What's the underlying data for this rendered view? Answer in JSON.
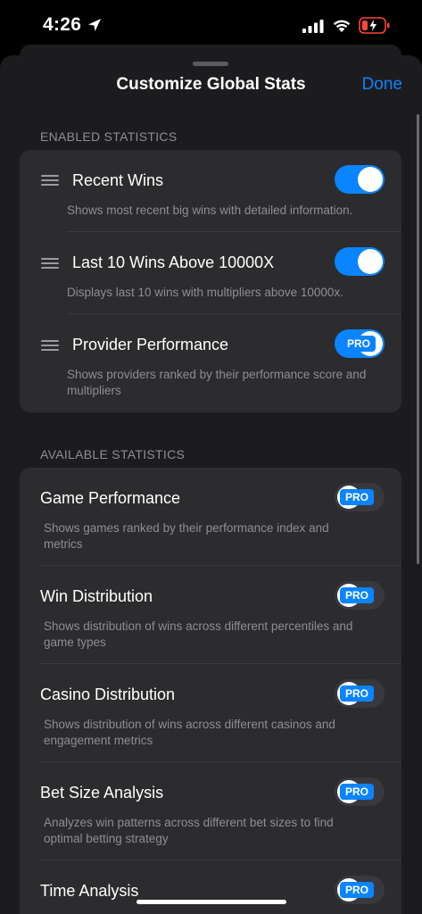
{
  "status_bar": {
    "time": "4:26"
  },
  "header": {
    "title": "Customize Global Stats",
    "done_label": "Done"
  },
  "enabled_section": {
    "heading": "ENABLED STATISTICS",
    "items": [
      {
        "title": "Recent Wins",
        "description": "Shows most recent big wins with detailed information.",
        "toggle": "on"
      },
      {
        "title": "Last 10 Wins Above 10000X",
        "description": "Displays last 10 wins with multipliers above 10000x.",
        "toggle": "on"
      },
      {
        "title": "Provider Performance",
        "description": "Shows providers ranked by their performance score and multipliers",
        "toggle": "pro-on",
        "badge": "PRO"
      }
    ]
  },
  "available_section": {
    "heading": "AVAILABLE STATISTICS",
    "items": [
      {
        "title": "Game Performance",
        "description": "Shows games ranked by their performance index and metrics",
        "badge": "PRO"
      },
      {
        "title": "Win Distribution",
        "description": "Shows distribution of wins across different percentiles and game types",
        "badge": "PRO"
      },
      {
        "title": "Casino Distribution",
        "description": "Shows distribution of wins across different casinos and engagement metrics",
        "badge": "PRO"
      },
      {
        "title": "Bet Size Analysis",
        "description": "Analyzes win patterns across different bet sizes to find optimal betting strategy",
        "badge": "PRO"
      },
      {
        "title": "Time Analysis",
        "description": "",
        "badge": "PRO"
      }
    ]
  },
  "colors": {
    "accent": "#0a84ff",
    "sheet": "#1c1c1e",
    "card": "#2c2c2e",
    "secondary_text": "#8e8e93"
  }
}
